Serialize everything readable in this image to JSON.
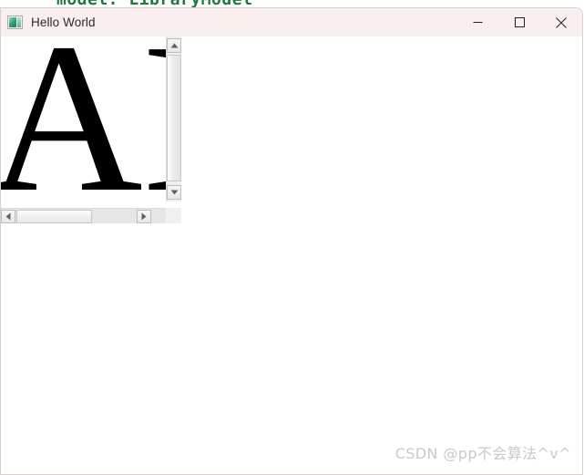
{
  "background_code_line": {
    "text": "model: LibraryModel",
    "color": "#1a7a3c"
  },
  "window": {
    "title": "Hello World",
    "icon_name": "qt-app-icon",
    "titlebar_color": "#f9efee",
    "client_color": "#ffffff",
    "controls": {
      "minimize_label": "Minimize",
      "maximize_label": "Maximize",
      "close_label": "Close"
    }
  },
  "scroll_area": {
    "name": "graphics-scroll-area",
    "content_text": "AB",
    "vertical_scrollbar": {
      "up_arrow_label": "Scroll up",
      "down_arrow_label": "Scroll down",
      "thumb_label": "Vertical scroll thumb"
    },
    "horizontal_scrollbar": {
      "left_arrow_label": "Scroll left",
      "right_arrow_label": "Scroll right",
      "thumb_label": "Horizontal scroll thumb"
    }
  },
  "watermark": {
    "text": "CSDN @pp不会算法^v^",
    "color": "#c9c9c9"
  }
}
